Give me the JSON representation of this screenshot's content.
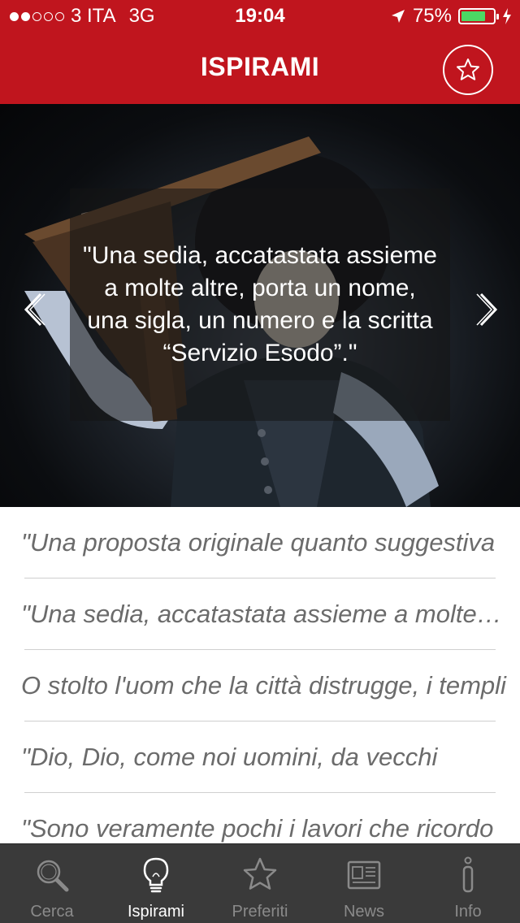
{
  "status_bar": {
    "carrier": "3 ITA",
    "network": "3G",
    "time": "19:04",
    "battery": "75%",
    "battery_level": 0.75,
    "signal_dots_filled": 2,
    "signal_dots_total": 5
  },
  "nav": {
    "title": "ISPIRAMI",
    "favorite_icon": "star-icon"
  },
  "hero": {
    "quote": "\"Una sedia, accatastata assieme a molte altre, porta un nome, una sigla, un numero e la scritta “Servizio Esodo”.\"",
    "prev_icon": "chevron-left-icon",
    "next_icon": "chevron-right-icon"
  },
  "list": [
    {
      "text": "\"Una proposta originale quanto suggestiva"
    },
    {
      "text": "\"Una sedia, accatastata assieme a molte altre"
    },
    {
      "text": "O stolto l'uom che la città distrugge, i templi"
    },
    {
      "text": "\"Dio, Dio, come noi uomini, da vecchi"
    },
    {
      "text": "\"Sono veramente pochi i lavori che ricordo"
    }
  ],
  "tabs": [
    {
      "label": "Cerca",
      "icon": "search-icon",
      "active": false
    },
    {
      "label": "Ispirami",
      "icon": "lightbulb-icon",
      "active": true
    },
    {
      "label": "Preferiti",
      "icon": "star-icon",
      "active": false
    },
    {
      "label": "News",
      "icon": "newspaper-icon",
      "active": false
    },
    {
      "label": "Info",
      "icon": "info-icon",
      "active": false
    }
  ],
  "colors": {
    "brand_red": "#c0151e",
    "tabbar_bg": "#3a3a3a",
    "battery_green": "#4cd964",
    "list_text": "#6b6b6b"
  }
}
